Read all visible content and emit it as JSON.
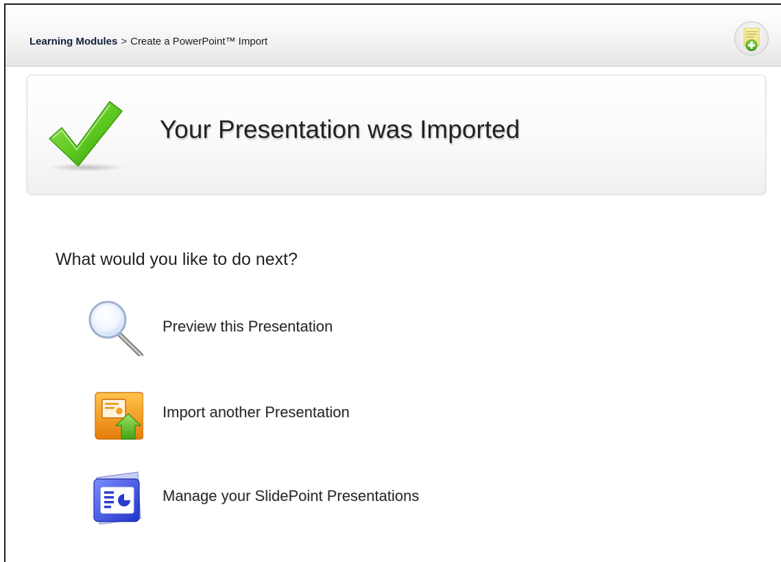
{
  "header": {
    "breadcrumb": {
      "parent": "Learning Modules",
      "separator": ">",
      "current": "Create a PowerPoint™ Import"
    },
    "add_note_icon": "sticky-note-add-icon"
  },
  "banner": {
    "icon": "checkmark-icon",
    "title": "Your Presentation was Imported"
  },
  "next": {
    "prompt": "What would you like to do next?",
    "actions": [
      {
        "icon": "magnifier-icon",
        "label": "Preview this Presentation"
      },
      {
        "icon": "import-presentation-icon",
        "label": "Import another Presentation"
      },
      {
        "icon": "manage-presentations-icon",
        "label": "Manage your SlidePoint Presentations"
      }
    ]
  },
  "colors": {
    "check_green": "#5cc81e",
    "import_orange": "#f39a16",
    "manage_blue": "#3648d8"
  }
}
